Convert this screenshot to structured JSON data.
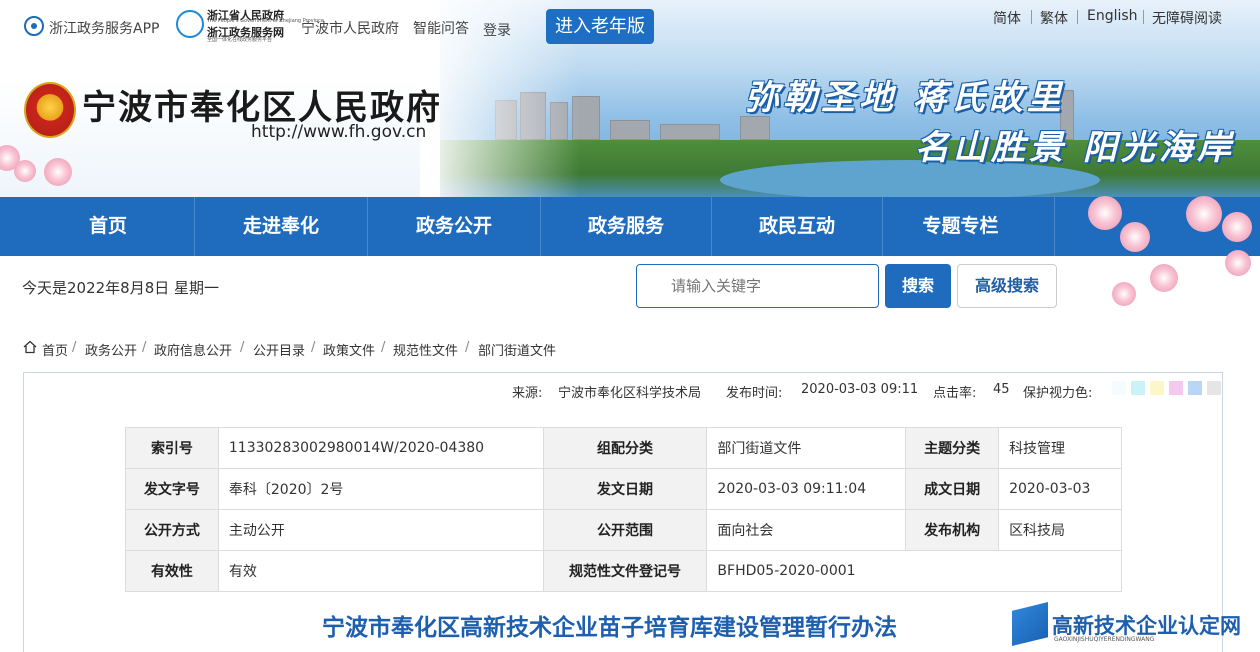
{
  "topbar": {
    "app_link": "浙江政务服务APP",
    "zj_logo_line1": "浙江省人民政府",
    "zj_logo_line1_en": "The People's Government of Zhejiang Province",
    "zj_logo_line2": "浙江政务服务网",
    "zj_logo_line2_en": "全国一体化在线政务服务平台",
    "ningbo_link": "宁波市人民政府",
    "qa_link": "智能问答",
    "login_link": "登录",
    "elder_button": "进入老年版",
    "lang_simplified": "简体",
    "lang_traditional": "繁体",
    "lang_english": "English",
    "accessibility": "无障碍阅读"
  },
  "header": {
    "site_title": "宁波市奉化区人民政府",
    "site_url": "http://www.fh.gov.cn",
    "slogan_line1": "弥勒圣地 蒋氏故里",
    "slogan_line2": "名山胜景 阳光海岸"
  },
  "nav": {
    "items": [
      "首页",
      "走进奉化",
      "政务公开",
      "政务服务",
      "政民互动",
      "专题专栏"
    ]
  },
  "toolbar": {
    "date_text": "今天是2022年8月8日  星期一",
    "search_placeholder": "请输入关键字",
    "search_button": "搜索",
    "advanced_search_button": "高级搜索"
  },
  "breadcrumb": [
    "首页",
    "政务公开",
    "政府信息公开",
    "公开目录",
    "政策文件",
    "规范性文件",
    "部门街道文件"
  ],
  "article_meta": {
    "source_label": "来源:",
    "source_value": "宁波市奉化区科学技术局",
    "publish_label": "发布时间:",
    "publish_value": "2020-03-03 09:11",
    "hits_label": "点击率:",
    "hits_value": "45",
    "eye_care_label": "保护视力色:",
    "eye_care_colors": [
      "#f5fbff",
      "#c9f3f6",
      "#fbf7c7",
      "#f3c9ee",
      "#b8d6f5",
      "#e5e5e5"
    ]
  },
  "info_table": {
    "rows": [
      [
        "索引号",
        "11330283002980014W/2020-04380",
        "组配分类",
        "部门街道文件",
        "主题分类",
        "科技管理"
      ],
      [
        "发文字号",
        "奉科〔2020〕2号",
        "发文日期",
        "2020-03-03 09:11:04",
        "成文日期",
        "2020-03-03"
      ],
      [
        "公开方式",
        "主动公开",
        "公开范围",
        "面向社会",
        "发布机构",
        "区科技局"
      ],
      [
        "有效性",
        "有效",
        "规范性文件登记号",
        "BFHD05-2020-0001"
      ]
    ]
  },
  "document": {
    "title": "宁波市奉化区高新技术企业苗子培育库建设管理暂行办法"
  },
  "watermark": {
    "text": "高新技术企业认定网",
    "subtext": "GAOXINJISHUQIYERENDINGWANG"
  }
}
